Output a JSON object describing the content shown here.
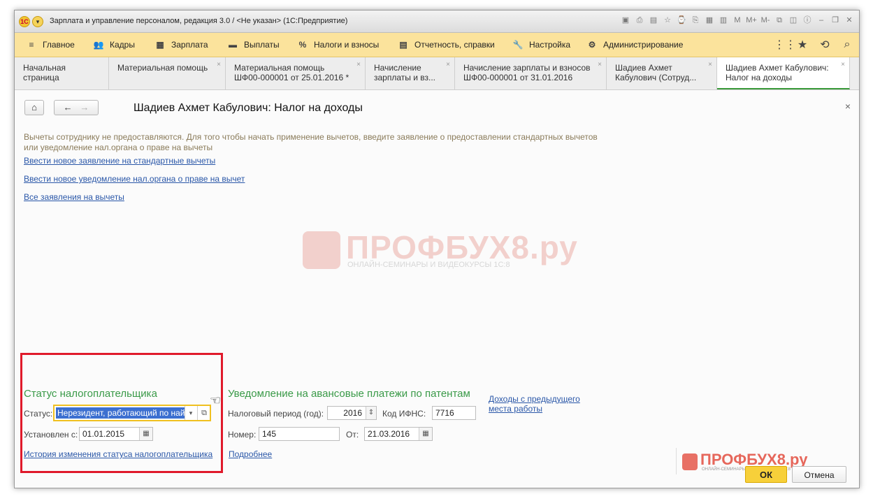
{
  "window": {
    "title": "Зарплата и управление персоналом, редакция 3.0 / <Не указан> (1С:Предприятие)"
  },
  "menu": {
    "items": [
      {
        "label": "Главное",
        "icon": "≡"
      },
      {
        "label": "Кадры",
        "icon": "👥"
      },
      {
        "label": "Зарплата",
        "icon": "▦"
      },
      {
        "label": "Выплаты",
        "icon": "▬"
      },
      {
        "label": "Налоги и взносы",
        "icon": "%"
      },
      {
        "label": "Отчетность, справки",
        "icon": "▤"
      },
      {
        "label": "Настройка",
        "icon": "🔧"
      },
      {
        "label": "Администрирование",
        "icon": "⚙"
      }
    ]
  },
  "tabs": [
    {
      "line1": "Начальная страница",
      "line2": ""
    },
    {
      "line1": "Материальная помощь",
      "line2": ""
    },
    {
      "line1": "Материальная помощь",
      "line2": "ШФ00-000001 от 25.01.2016 *"
    },
    {
      "line1": "Начисление",
      "line2": "зарплаты и вз..."
    },
    {
      "line1": "Начисление зарплаты и взносов",
      "line2": "ШФ00-000001 от 31.01.2016"
    },
    {
      "line1": "Шадиев Ахмет",
      "line2": "Кабулович (Сотруд..."
    },
    {
      "line1": "Шадиев Ахмет Кабулович:",
      "line2": "Налог на доходы"
    }
  ],
  "form": {
    "title": "Шадиев Ахмет Кабулович: Налог на доходы",
    "info_text": "Вычеты сотруднику не предоставляются. Для того чтобы начать применение вычетов, введите заявление о предоставлении стандартных вычетов или уведомление нал.органа о праве на вычеты",
    "link_new_application": "Ввести новое заявление на стандартные вычеты",
    "link_new_notice": "Ввести новое уведомление нал.органа о праве на вычет",
    "link_all_applications": "Все заявления на вычеты"
  },
  "watermark": {
    "title": "ПРОФБУХ8.ру",
    "subtitle": "ОНЛАЙН-СЕМИНАРЫ И ВИДЕОКУРСЫ 1С:8"
  },
  "taxpayer": {
    "section_title": "Статус налогоплательщика",
    "status_label": "Статус:",
    "status_value": "Нерезидент, работающий по найму",
    "since_label": "Установлен с:",
    "since_value": "01.01.2015",
    "history_link": "История изменения статуса налогоплательщика"
  },
  "patent": {
    "section_title": "Уведомление на авансовые платежи по патентам",
    "period_label": "Налоговый период (год):",
    "period_value": "2016",
    "ifns_label": "Код ИФНС:",
    "ifns_value": "7716",
    "number_label": "Номер:",
    "number_value": "145",
    "date_label": "От:",
    "date_value": "21.03.2016",
    "more_link": "Подробнее"
  },
  "prev_income_link": "Доходы с предыдущего места работы",
  "buttons": {
    "ok": "ОК",
    "cancel": "Отмена"
  },
  "colors": {
    "menu_bg": "#fbe39c",
    "section_green": "#3a9a48",
    "link_blue": "#2a57a8",
    "ok_yellow": "#f7d03a",
    "highlight_red": "#e01a2b"
  }
}
